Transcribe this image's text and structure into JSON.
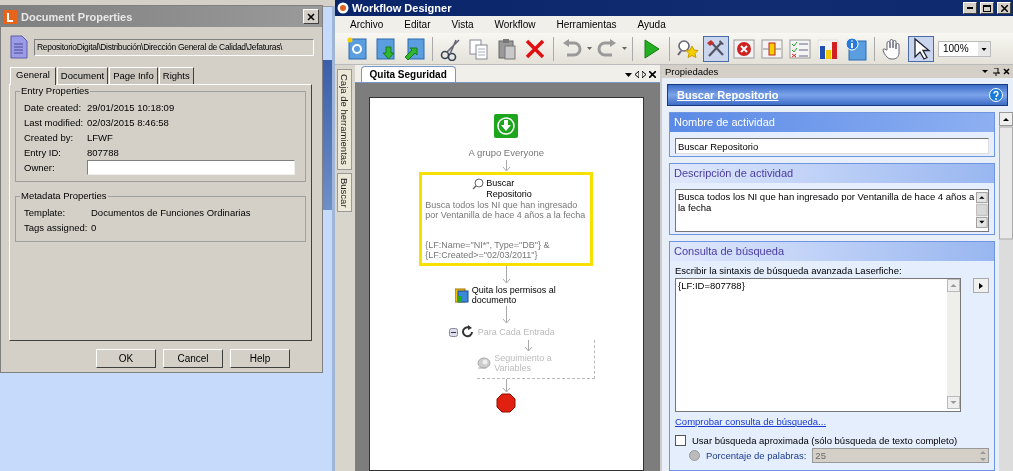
{
  "dialog": {
    "title": "Document Properties",
    "path": "RepositorioDigital\\Distribución\\Dirección General de Calidad\\Jefaturas\\",
    "tabs": [
      {
        "label": "General",
        "selected": true
      },
      {
        "label": "Document",
        "selected": false
      },
      {
        "label": "Page Info",
        "selected": false
      },
      {
        "label": "Rights",
        "selected": false
      }
    ],
    "groups": [
      {
        "title": "Entry Properties",
        "rows": [
          {
            "kind": "text",
            "label": "Date created:",
            "value": "29/01/2015 10:18:09"
          },
          {
            "kind": "text",
            "label": "Last modified:",
            "value": "02/03/2015 8:46:58"
          },
          {
            "kind": "text",
            "label": "Created by:",
            "value": "LFWF"
          },
          {
            "kind": "text",
            "label": "Entry ID:",
            "value": "807788"
          },
          {
            "kind": "field",
            "label": "Owner:"
          }
        ]
      },
      {
        "title": "Metadata Properties",
        "rows": [
          {
            "kind": "text",
            "label": "Template:",
            "value": "Documentos de Funciones Ordinarias"
          },
          {
            "kind": "text",
            "label": "Tags assigned:",
            "value": "0"
          }
        ]
      }
    ],
    "buttons": [
      "OK",
      "Cancel",
      "Help"
    ]
  },
  "designer": {
    "title": "Workflow Designer",
    "menu": [
      "Archivo",
      "Editar",
      "Vista",
      "Workflow",
      "Herramientas",
      "Ayuda"
    ],
    "toolbar": [
      {
        "kind": "new",
        "selected": false
      },
      {
        "kind": "import",
        "selected": false
      },
      {
        "kind": "export",
        "selected": false
      },
      {
        "kind": "separator"
      },
      {
        "kind": "cut",
        "selected": false
      },
      {
        "kind": "copy",
        "selected": false
      },
      {
        "kind": "paste",
        "selected": false
      },
      {
        "kind": "delete",
        "selected": false
      },
      {
        "kind": "separator"
      },
      {
        "kind": "undo",
        "selected": false
      },
      {
        "kind": "redo",
        "selected": false
      },
      {
        "kind": "separator"
      },
      {
        "kind": "run",
        "selected": false
      },
      {
        "kind": "separator"
      },
      {
        "kind": "find",
        "selected": false
      },
      {
        "kind": "tools",
        "selected": true
      },
      {
        "kind": "error",
        "selected": false
      },
      {
        "kind": "layout",
        "selected": false
      },
      {
        "kind": "checklist",
        "selected": false
      },
      {
        "kind": "chart",
        "selected": false
      },
      {
        "kind": "info",
        "selected": false
      },
      {
        "kind": "separator"
      },
      {
        "kind": "hand",
        "selected": false
      },
      {
        "kind": "pointer",
        "selected": true
      }
    ],
    "zoom": "100%",
    "side_tabs": [
      "Caja de herramientas",
      "Buscar"
    ],
    "doc_tab": "Quita Seguridad",
    "flow": [
      {
        "kind": "start",
        "label": "A grupo Everyone",
        "disabled": false
      },
      {
        "kind": "search",
        "title": "Buscar Repositorio",
        "description": "Busca todos los NI que han ingresado por Ventanilla de hace 4 años a la fecha",
        "query": "{LF:Name=\"NI*\", Type=\"DB\"} & {LF:Created>=\"02/03/2011\"}",
        "selected": true,
        "disabled": false
      },
      {
        "kind": "activity",
        "label": "Quita los permisos al documento",
        "disabled": false
      },
      {
        "kind": "loop",
        "label": "Para Cada Entrada",
        "disabled": true,
        "children": [
          {
            "kind": "variables",
            "label": "Seguimiento a Variables",
            "disabled": true
          }
        ]
      },
      {
        "kind": "stop"
      }
    ],
    "properties": {
      "title": "Propiedades",
      "heading": "Buscar Repositorio",
      "sections": [
        {
          "kind": "field",
          "title": "Nombre de actividad",
          "selected": true,
          "value": "Buscar Repositorio"
        },
        {
          "kind": "textarea",
          "title": "Descripción de actividad",
          "selected": false,
          "value": "Busca todos los NI que han ingresado por Ventanilla de hace 4 años a la fecha"
        },
        {
          "kind": "query",
          "title": "Consulta de búsqueda",
          "selected": false,
          "label": "Escribir la sintaxis de búsqueda avanzada Laserfiche:",
          "value": "{LF:ID=807788}",
          "link": "Comprobar consulta de búsqueda...",
          "fuzzy": {
            "label": "Usar búsqueda aproximada (sólo búsqueda de texto completo)",
            "checked": false
          },
          "percent": {
            "label": "Porcentaje de palabras:",
            "value": "25",
            "selected": false,
            "disabled": true
          }
        }
      ]
    }
  }
}
